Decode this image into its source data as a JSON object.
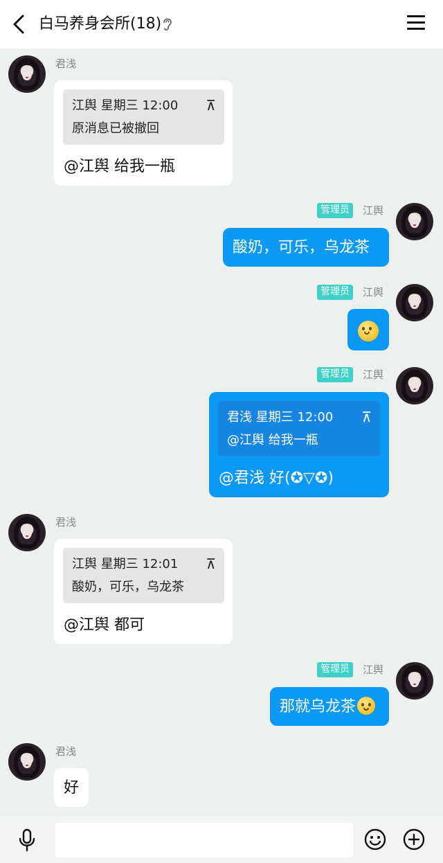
{
  "header": {
    "back_icon": "chevron-left-icon",
    "title": "白马养身会所(18)",
    "ear_icon": "ear-icon",
    "menu_icon": "menu-icon"
  },
  "messages": [
    {
      "side": "left",
      "sender": "君浅",
      "quote": {
        "from": "江舆",
        "time": "星期三 12:00",
        "text": "原消息已被撤回"
      },
      "text": "@江舆 给我一瓶"
    },
    {
      "side": "right",
      "badge": "管理员",
      "sender": "江舆",
      "text": "酸奶，可乐，乌龙茶"
    },
    {
      "side": "right",
      "badge": "管理员",
      "sender": "江舆",
      "emoji": "smile-emoji-icon"
    },
    {
      "side": "right",
      "badge": "管理员",
      "sender": "江舆",
      "quote": {
        "from": "君浅",
        "time": "星期三 12:00",
        "text": "@江舆 给我一瓶"
      },
      "text": "@君浅 好(✪▽✪)"
    },
    {
      "side": "left",
      "sender": "君浅",
      "quote": {
        "from": "江舆",
        "time": "星期三 12:01",
        "text": "酸奶，可乐，乌龙茶"
      },
      "text": "@江舆 都可"
    },
    {
      "side": "right",
      "badge": "管理员",
      "sender": "江舆",
      "text": "那就乌龙茶"
    },
    {
      "side": "left",
      "sender": "君浅",
      "text": "好"
    }
  ],
  "quote_up_glyph": "⊼",
  "input": {
    "placeholder": "",
    "value": ""
  },
  "colors": {
    "accent": "#0b99f5",
    "badge": "#3dd1c7",
    "background": "#ecf1ee"
  }
}
